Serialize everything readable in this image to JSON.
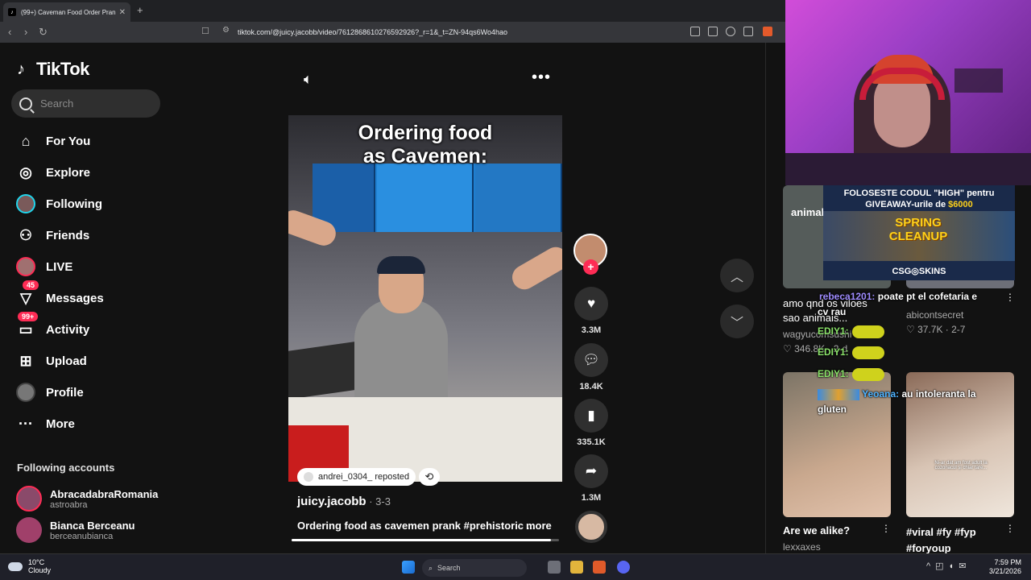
{
  "browser": {
    "tab_title": "(99+) Caveman Food Order Prank",
    "tab_close": "✕",
    "new_tab": "+",
    "url": "tiktok.com/@juicy.jacobb/video/7612868610276592926?_r=1&_t=ZN-94qs6Wo4hao"
  },
  "sidebar": {
    "logo_text": "TikTok",
    "search_placeholder": "Search",
    "nav": [
      {
        "label": "For You"
      },
      {
        "label": "Explore"
      },
      {
        "label": "Following"
      },
      {
        "label": "Friends"
      },
      {
        "label": "LIVE"
      },
      {
        "label": "Messages",
        "badge": "45"
      },
      {
        "label": "Activity",
        "badge": "99+"
      },
      {
        "label": "Upload"
      },
      {
        "label": "Profile"
      },
      {
        "label": "More"
      }
    ],
    "following_header": "Following accounts",
    "following": [
      {
        "name": "AbracadabraRomania",
        "username": "astroabra"
      },
      {
        "name": "Bianca Berceanu",
        "username": "berceanubianca"
      }
    ]
  },
  "video": {
    "caption_line1": "Ordering food",
    "caption_line2": "as Cavemen:",
    "reposted_by": "andrei_0304_ reposted",
    "author": "juicy.jacobb",
    "date": " · 3-3",
    "description": "Ordering food as cavemen prank #prehistoric ...",
    "more": "more",
    "progress": 0.97
  },
  "actions": {
    "likes": "3.3M",
    "comments": "18.4K",
    "saves": "335.1K",
    "shares": "1.3M"
  },
  "stream_overlay": {
    "promo_line1": "FOLOSESTE CODUL \"HIGH\" pentru",
    "promo_line2a": "GIVEAWAY-urile de ",
    "promo_line2b": "$6000",
    "promo_title": "SPRING CLEANUP",
    "promo_brand": "CSG◎SKINS",
    "chat": [
      {
        "user": "rebeca1201:",
        "msg": "poate pt el cofetaria e"
      },
      {
        "user": "",
        "msg": "cv rau"
      },
      {
        "user": "EDIY1:",
        "msg": ""
      },
      {
        "user": "EDIY1:",
        "msg": ""
      },
      {
        "user": "EDIY1:",
        "msg": ""
      },
      {
        "user": "Yeoana:",
        "msg": "au intoleranta la"
      },
      {
        "user": "",
        "msg": "gluten"
      }
    ]
  },
  "recommended": [
    {
      "title_line1": "animal",
      "title": "amo qnd os viloes",
      "title2": "sao animais...",
      "author": "wagyucomsushi",
      "stats": "346.8K · 2-d"
    },
    {
      "title": "",
      "author": "abicontsecret",
      "stats": "37.7K · 2-7"
    },
    {
      "title": "Are we alike?",
      "author": "lexxaxes"
    },
    {
      "title": "#viral #fy #fyp",
      "title2": "#foryoup",
      "overlay": "Ni-ar dat am fost adult la cozonacul și chiar tare..."
    }
  ],
  "taskbar": {
    "temp": "10°C",
    "weather": "Cloudy",
    "search": "Search",
    "time": "7:59 PM",
    "date": "3/21/2026"
  }
}
